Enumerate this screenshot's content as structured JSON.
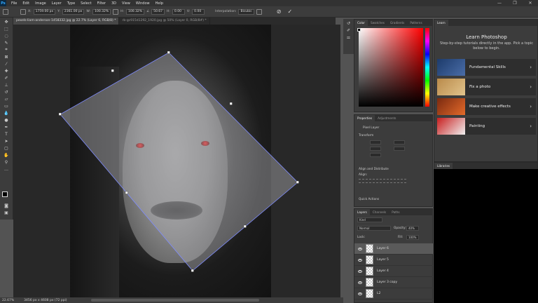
{
  "app": {
    "logo": "Ps"
  },
  "menubar": [
    "File",
    "Edit",
    "Image",
    "Layer",
    "Type",
    "Select",
    "Filter",
    "3D",
    "View",
    "Window",
    "Help"
  ],
  "window_controls": [
    "—",
    "❐",
    "✕"
  ],
  "options": {
    "x_label": "X:",
    "x_value": "1759.00 px",
    "y_label": "Y:",
    "y_value": "2361.00 px",
    "w_label": "W:",
    "w_value": "100.32%",
    "h_label": "H:",
    "h_value": "100.32%",
    "angle_value": "50.67",
    "hskew_label": "H:",
    "hskew_value": "0.00",
    "vskew_label": "V:",
    "vskew_value": "0.00",
    "interp_label": "Interpolation:",
    "interp_value": "Bicubic"
  },
  "tabs": [
    "pexels-liam-anderson-1458332.jpg @ 22.7% (Layer 6, RGB/8) *",
    "rb-gc915d1292_1920.jpg @ 50% (Layer 0, RGB/8#) *"
  ],
  "status": {
    "zoom": "22.67%",
    "doc": "3456 px x 4608 px (72 ppi)"
  },
  "color_panel": {
    "tabs": [
      "Color",
      "Swatches",
      "Gradients",
      "Patterns"
    ]
  },
  "properties_panel": {
    "tabs": [
      "Properties",
      "Adjustments"
    ],
    "kind": "Pixel Layer",
    "transform_label": "Transform",
    "align_label": "Align and Distribute",
    "align_sub": "Align:",
    "quick_label": "Quick Actions"
  },
  "layers_panel": {
    "tabs": [
      "Layers",
      "Channels",
      "Paths"
    ],
    "search": "Kind",
    "blend_mode": "Normal",
    "opacity_label": "Opacity:",
    "opacity_value": "40%",
    "lock_label": "Lock:",
    "fill_label": "Fill:",
    "fill_value": "100%",
    "layers": [
      "Layer 6",
      "Layer 5",
      "Layer 4",
      "Layer 3 copy",
      "L2"
    ]
  },
  "learn_panel": {
    "tab": "Learn",
    "title": "Learn Photoshop",
    "subtitle": "Step-by-step tutorials directly in the app. Pick a topic below to begin.",
    "items": [
      "Fundamental Skills",
      "Fix a photo",
      "Make creative effects",
      "Painting"
    ]
  },
  "libraries_panel": {
    "tab": "Libraries"
  },
  "icons": [
    "ps-logo-icon",
    "move-icon",
    "marquee-icon",
    "lasso-icon",
    "crop-icon",
    "eyedropper-icon",
    "brush-icon",
    "eraser-icon",
    "type-icon",
    "hand-icon",
    "zoom-icon",
    "eye-icon",
    "chevron-right-icon",
    "cancel-transform-icon",
    "commit-transform-icon"
  ],
  "colors": {
    "accent": "#31a8ff",
    "selected_layer": "#5a5a5a",
    "panel": "#3c3c3c"
  }
}
